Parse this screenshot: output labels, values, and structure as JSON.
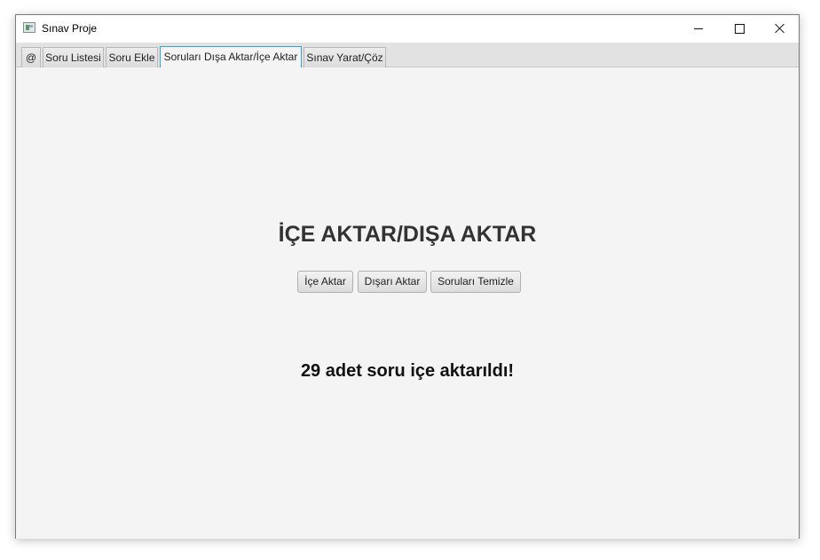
{
  "window": {
    "title": "Sınav Proje"
  },
  "tabs": [
    {
      "label": "@"
    },
    {
      "label": "Soru Listesi"
    },
    {
      "label": "Soru Ekle"
    },
    {
      "label": "Soruları Dışa Aktar/İçe Aktar",
      "selected": true
    },
    {
      "label": "Sınav Yarat/Çöz"
    }
  ],
  "main": {
    "heading": "İÇE AKTAR/DIŞA AKTAR",
    "buttons": {
      "import_label": "İçe Aktar",
      "export_label": "Dışarı Aktar",
      "clear_label": "Soruları Temizle"
    },
    "status": "29 adet soru içe aktarıldı!"
  },
  "colors": {
    "accent": "#3c9fd6",
    "background": "#f4f4f4",
    "heading": "#333333"
  },
  "icons": [
    "app-icon",
    "minimize-icon",
    "maximize-icon",
    "close-icon"
  ]
}
